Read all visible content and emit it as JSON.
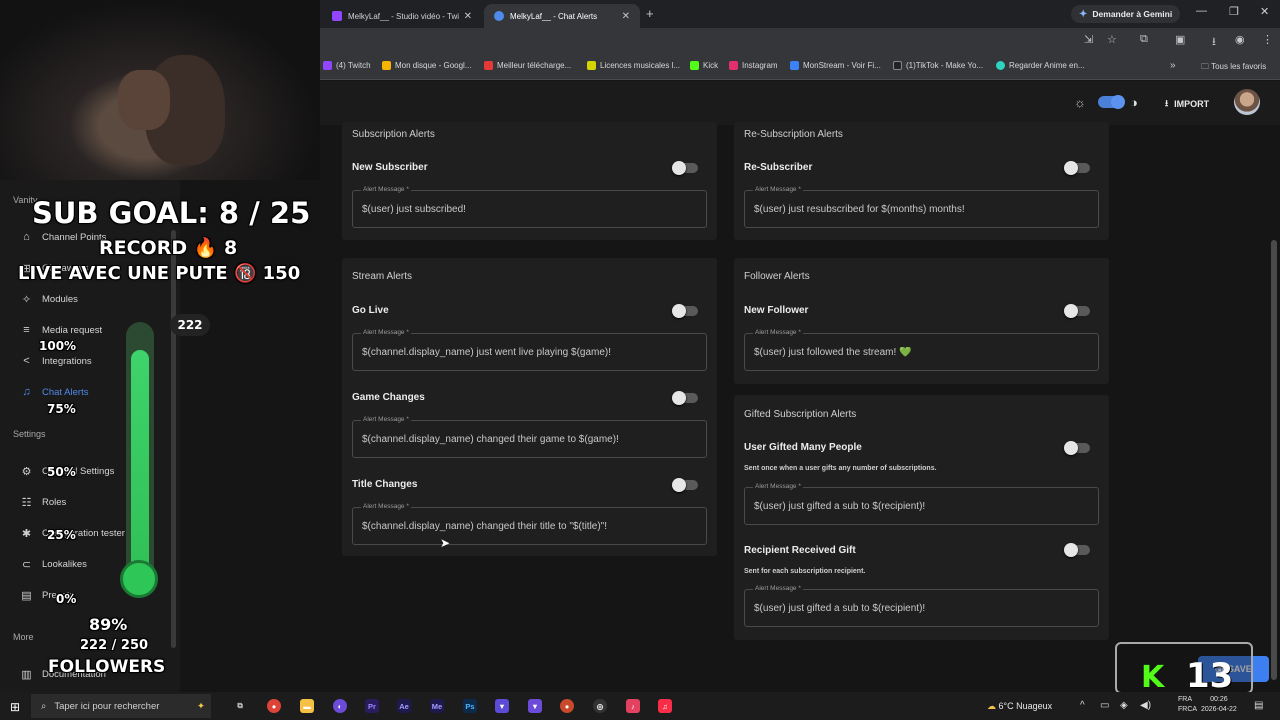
{
  "browser": {
    "tabs": [
      {
        "label": "MelkyLaf__ - Studio vidéo - Twi",
        "active": false,
        "color": "#9146ff"
      },
      {
        "label": "MelkyLaf__ - Chat Alerts",
        "active": true,
        "color": "#4f8bea"
      }
    ],
    "gemini_label": "Demander à Gemini",
    "bookmarks": [
      {
        "label": "(4) Twitch",
        "color": "#9146ff"
      },
      {
        "label": "Mon disque - Googl...",
        "color": "#f4b400"
      },
      {
        "label": "Meilleur télécharge...",
        "color": "#e53935"
      },
      {
        "label": "Licences musicales l...",
        "color": "#d4d400"
      },
      {
        "label": "Kick",
        "color": "#53fc18"
      },
      {
        "label": "Instagram",
        "color": "#e1306c"
      },
      {
        "label": "MonStream - Voir Fi...",
        "color": "#3b82f6"
      },
      {
        "label": "(1)TikTok - Make Yo...",
        "color": "#222222"
      },
      {
        "label": "Regarder Anime en...",
        "color": "#2dd4bf"
      }
    ],
    "all_bookmarks": "Tous les favoris"
  },
  "header": {
    "import_label": "IMPORT"
  },
  "sidebar": {
    "groups": {
      "vanity": "Vanity",
      "settings": "Settings",
      "more": "More"
    },
    "items": [
      {
        "label": "Channel Points",
        "icon": "tag-icon"
      },
      {
        "label": "Giveaways",
        "icon": "gift-icon"
      },
      {
        "label": "Modules",
        "icon": "sparkle-icon"
      },
      {
        "label": "Media request",
        "icon": "playlist-icon"
      },
      {
        "label": "Integrations",
        "icon": "share-icon"
      },
      {
        "label": "Chat Alerts",
        "icon": "bell-icon",
        "active": true
      },
      {
        "label": "Channel Settings",
        "icon": "gear-icon"
      },
      {
        "label": "Roles",
        "icon": "users-icon"
      },
      {
        "label": "Configuration tester",
        "icon": "bug-icon"
      },
      {
        "label": "Lookalikes",
        "icon": "link-icon"
      },
      {
        "label": "Presets",
        "icon": "doc-icon"
      },
      {
        "label": "Documentation",
        "icon": "book-icon"
      }
    ]
  },
  "overlay": {
    "sub_goal": "SUB GOAL: 8 / 25",
    "record": "RECORD 🔥 8",
    "live_text": "LIVE AVEC UNE PUTE 🔞 150",
    "badge": "222",
    "pct_100": "100%",
    "pct_75": "75%",
    "pct_50": "50%",
    "pct_25": "25%",
    "pct_0": "0%",
    "progress_pct": "89%",
    "followers_count": "222 / 250",
    "followers_label": "FOLLOWERS",
    "followers_progress": 0.89,
    "kick_count": "13"
  },
  "cards": {
    "subscription": {
      "title": "Subscription Alerts",
      "row_label": "New Subscriber",
      "field_label": "Alert Message *",
      "message": "$(user) just subscribed!"
    },
    "resubscription": {
      "title": "Re-Subscription Alerts",
      "row_label": "Re-Subscriber",
      "field_label": "Alert Message *",
      "message": "$(user) just resubscribed for $(months) months!"
    },
    "stream": {
      "title": "Stream Alerts",
      "rows": [
        {
          "label": "Go Live",
          "field_label": "Alert Message *",
          "message": "$(channel.display_name) just went live playing $(game)!"
        },
        {
          "label": "Game Changes",
          "field_label": "Alert Message *",
          "message": "$(channel.display_name) changed their game to $(game)!"
        },
        {
          "label": "Title Changes",
          "field_label": "Alert Message *",
          "message": "$(channel.display_name) changed their title to \"$(title)\"!"
        }
      ]
    },
    "follower": {
      "title": "Follower Alerts",
      "row_label": "New Follower",
      "field_label": "Alert Message *",
      "message": "$(user) just followed the stream! 💚"
    },
    "gifted": {
      "title": "Gifted Subscription Alerts",
      "rows": [
        {
          "label": "User Gifted Many People",
          "sub": "Sent once when a user gifts any number of subscriptions.",
          "field_label": "Alert Message *",
          "message": "$(user) just gifted a sub to $(recipient)!"
        },
        {
          "label": "Recipient Received Gift",
          "sub": "Sent for each subscription recipient.",
          "field_label": "Alert Message *",
          "message": "$(user) just gifted a sub to $(recipient)!"
        }
      ]
    }
  },
  "save_label": "SAVE",
  "taskbar": {
    "search_placeholder": "Taper ici pour rechercher",
    "weather": "6°C Nuageux",
    "lang1": "FRA",
    "lang2": "FRCA",
    "time": "00:26",
    "date": "2026-04-22"
  }
}
